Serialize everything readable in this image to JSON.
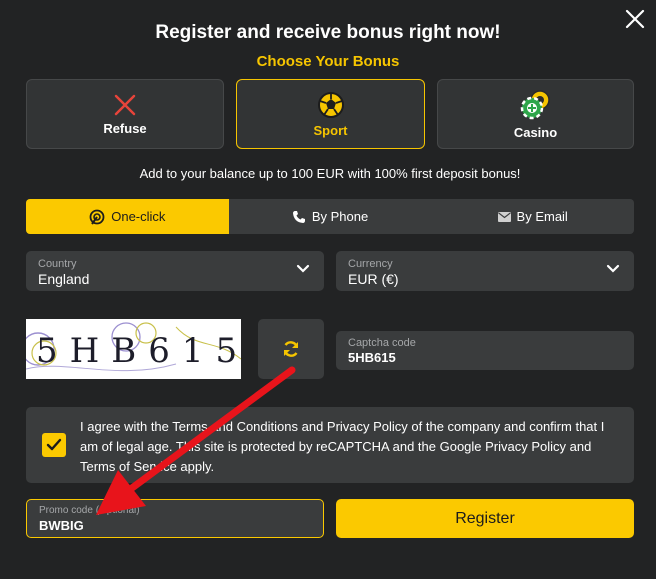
{
  "title": "Register and receive bonus right now!",
  "subtitle": "Choose Your Bonus",
  "bonus_options": [
    {
      "label": "Refuse",
      "icon": "cross-icon"
    },
    {
      "label": "Sport",
      "icon": "soccer-ball-icon",
      "selected": true
    },
    {
      "label": "Casino",
      "icon": "casino-chips-icon"
    }
  ],
  "bonus_description": "Add to your balance up to 100 EUR with 100% first deposit bonus!",
  "tabs": [
    {
      "label": "One-click",
      "icon": "one-click-icon",
      "active": true
    },
    {
      "label": "By Phone",
      "icon": "phone-icon"
    },
    {
      "label": "By Email",
      "icon": "envelope-icon"
    }
  ],
  "country": {
    "label": "Country",
    "value": "England"
  },
  "currency": {
    "label": "Currency",
    "value": "EUR (€)"
  },
  "captcha": {
    "image_text": "5HB615",
    "label": "Captcha code",
    "value": "5HB615"
  },
  "agreement": {
    "checked": true,
    "text": "I agree with the Terms and Conditions and Privacy Policy of the company and confirm that I am of legal age. This site is protected by reCAPTCHA and the Google Privacy Policy and Terms of Service apply."
  },
  "promo": {
    "label": "Promo code (Optional)",
    "value": "BWBIG"
  },
  "register_label": "Register",
  "colors": {
    "accent": "#fbc900",
    "background": "#222324",
    "field": "#3a3c3d",
    "arrow": "#e8141b"
  }
}
